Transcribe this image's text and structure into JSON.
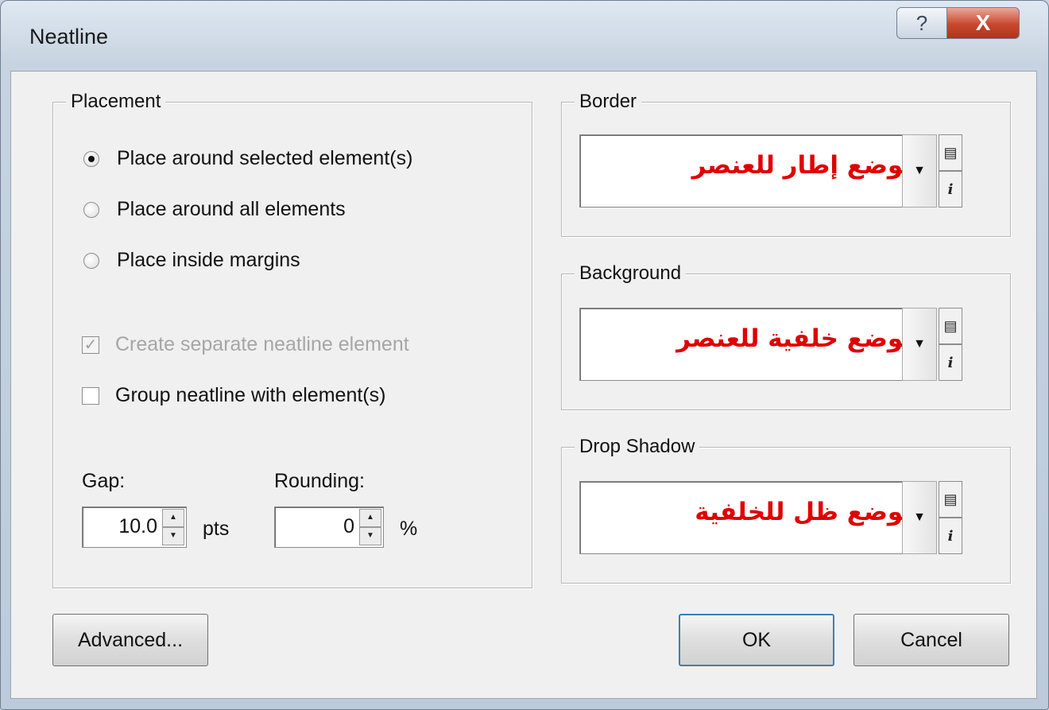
{
  "window": {
    "title": "Neatline",
    "help_label": "?",
    "close_label": "X"
  },
  "placement": {
    "label": "Placement",
    "radios": [
      {
        "label": "Place around selected element(s)",
        "selected": true
      },
      {
        "label": "Place around all elements",
        "selected": false
      },
      {
        "label": "Place inside margins",
        "selected": false
      }
    ],
    "checkboxes": [
      {
        "label": "Create separate neatline element",
        "checked": true,
        "disabled": true
      },
      {
        "label": "Group neatline with element(s)",
        "checked": false,
        "disabled": false
      }
    ],
    "gap": {
      "label": "Gap:",
      "value": "10.0",
      "unit": "pts"
    },
    "rounding": {
      "label": "Rounding:",
      "value": "0",
      "unit": "%"
    }
  },
  "border": {
    "label": "Border",
    "value": "لوضع إطار للعنصر"
  },
  "background": {
    "label": "Background",
    "value": "لوضع خلفية للعنصر"
  },
  "drop_shadow": {
    "label": "Drop Shadow",
    "value": "لوضع ظل للخلفية"
  },
  "buttons": {
    "advanced": "Advanced...",
    "ok": "OK",
    "cancel": "Cancel"
  },
  "icons": {
    "spin_up": "▲",
    "spin_down": "▼",
    "dropdown": "▼",
    "symbol_list": "▤",
    "info": "i",
    "check_mark": "✓"
  }
}
